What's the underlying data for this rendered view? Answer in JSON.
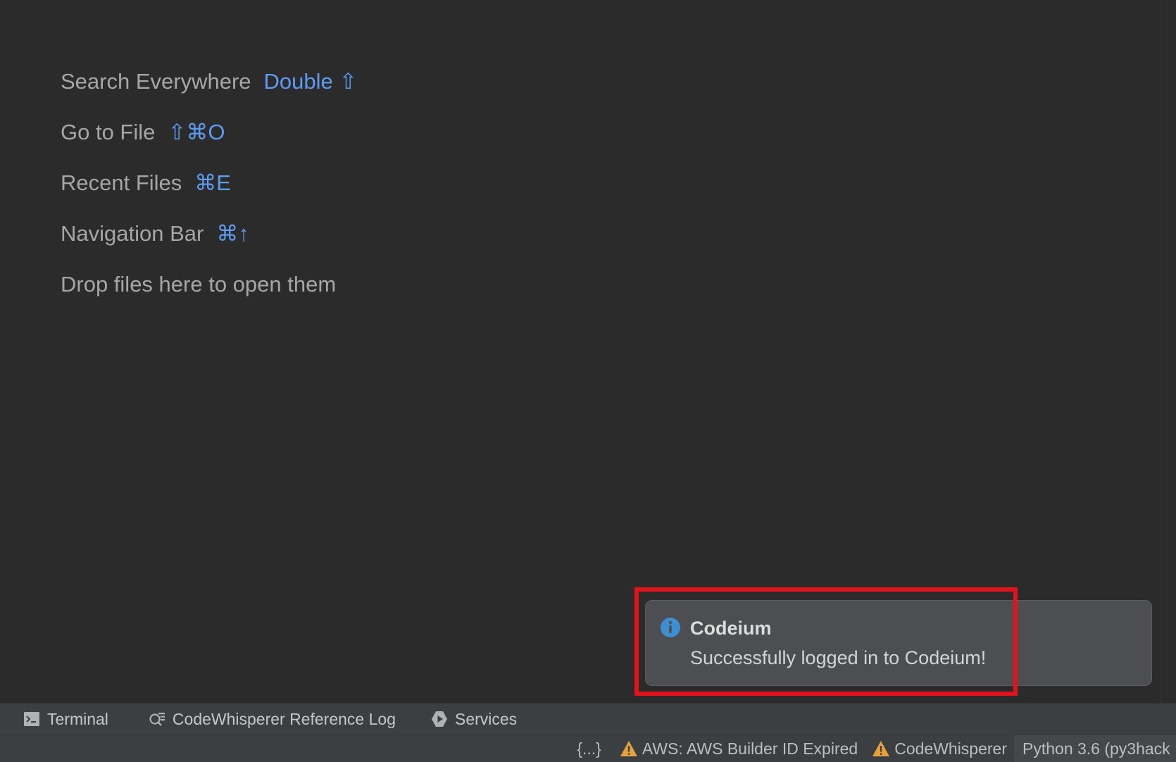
{
  "hints": [
    {
      "action": "Search Everywhere",
      "shortcut": "Double ⇧"
    },
    {
      "action": "Go to File",
      "shortcut": "⇧⌘O"
    },
    {
      "action": "Recent Files",
      "shortcut": "⌘E"
    },
    {
      "action": "Navigation Bar",
      "shortcut": "⌘↑"
    },
    {
      "action": "Drop files here to open them",
      "shortcut": ""
    }
  ],
  "notification": {
    "icon": "info-icon",
    "title": "Codeium",
    "message": "Successfully logged in to Codeium!"
  },
  "tool_windows": [
    {
      "icon": "terminal-icon",
      "label": "Terminal"
    },
    {
      "icon": "reference-log-icon",
      "label": "CodeWhisperer Reference Log"
    },
    {
      "icon": "services-icon",
      "label": "Services"
    }
  ],
  "status_bar": {
    "braces": "{...}",
    "aws_status": "AWS: AWS Builder ID Expired",
    "codewhisperer": "CodeWhisperer",
    "interpreter": "Python 3.6 (py3hack"
  },
  "colors": {
    "background": "#2b2b2c",
    "shortcut": "#5e9cf2",
    "warning": "#e6a23c",
    "info": "#3d8fd1",
    "highlight": "#e2131b"
  }
}
